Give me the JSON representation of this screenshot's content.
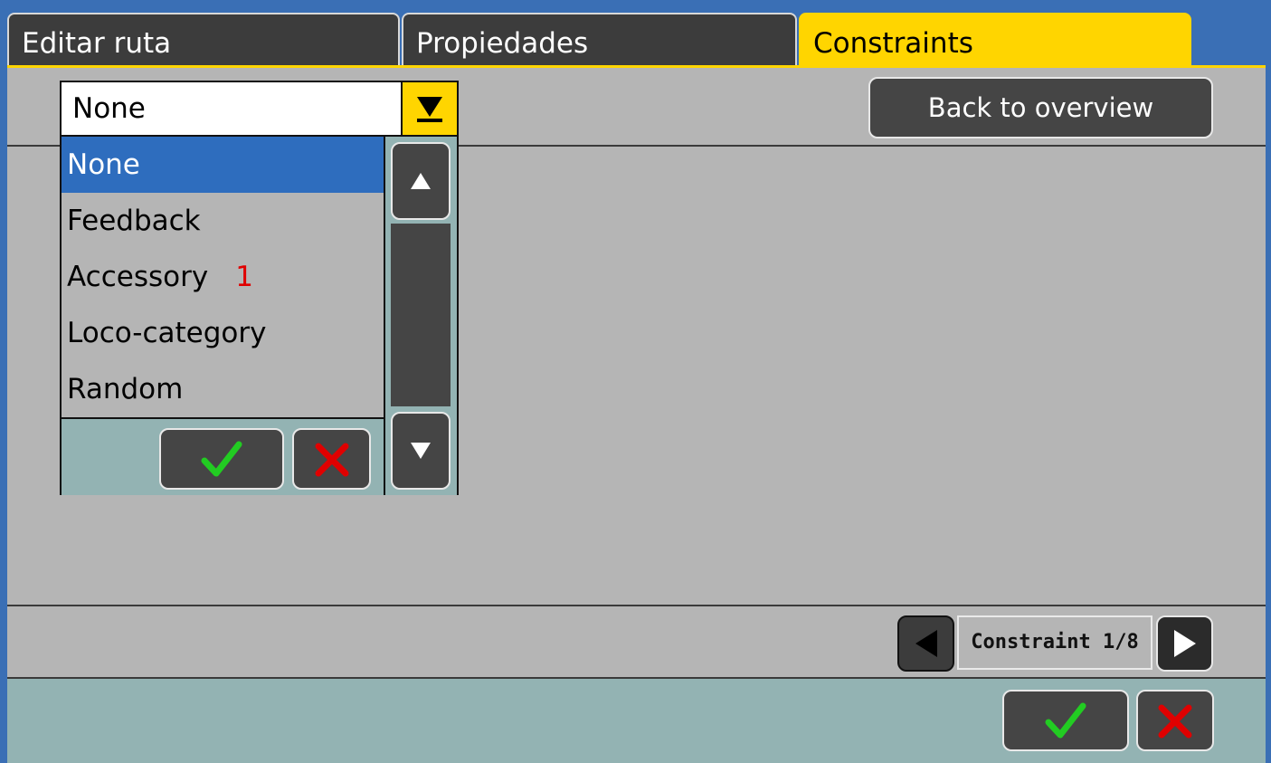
{
  "tabs": [
    {
      "label": "Editar ruta",
      "active": false
    },
    {
      "label": "Propiedades",
      "active": false
    },
    {
      "label": "Constraints",
      "active": true
    }
  ],
  "combo": {
    "selected": "None"
  },
  "dropdown": {
    "items": [
      {
        "label": "None",
        "selected": true,
        "badge": ""
      },
      {
        "label": "Feedback",
        "selected": false,
        "badge": ""
      },
      {
        "label": "Accessory",
        "selected": false,
        "badge": "1"
      },
      {
        "label": "Loco-category",
        "selected": false,
        "badge": ""
      },
      {
        "label": "Random",
        "selected": false,
        "badge": ""
      }
    ]
  },
  "back_button": {
    "label": "Back to overview"
  },
  "pager": {
    "label": "Constraint 1/8"
  },
  "icons": {
    "dropdown_toggle": "triangle-down-icon",
    "scroll_up": "triangle-up-icon",
    "scroll_down": "triangle-down-icon",
    "confirm": "checkmark-icon",
    "cancel": "cross-icon",
    "prev": "triangle-left-icon",
    "next": "triangle-right-icon"
  },
  "colors": {
    "active_tab": "#ffd500",
    "selection": "#2e6dbe",
    "panel": "#b5b5b5",
    "footer": "#93b3b3",
    "confirm": "#22cc22",
    "cancel": "#e00000"
  }
}
